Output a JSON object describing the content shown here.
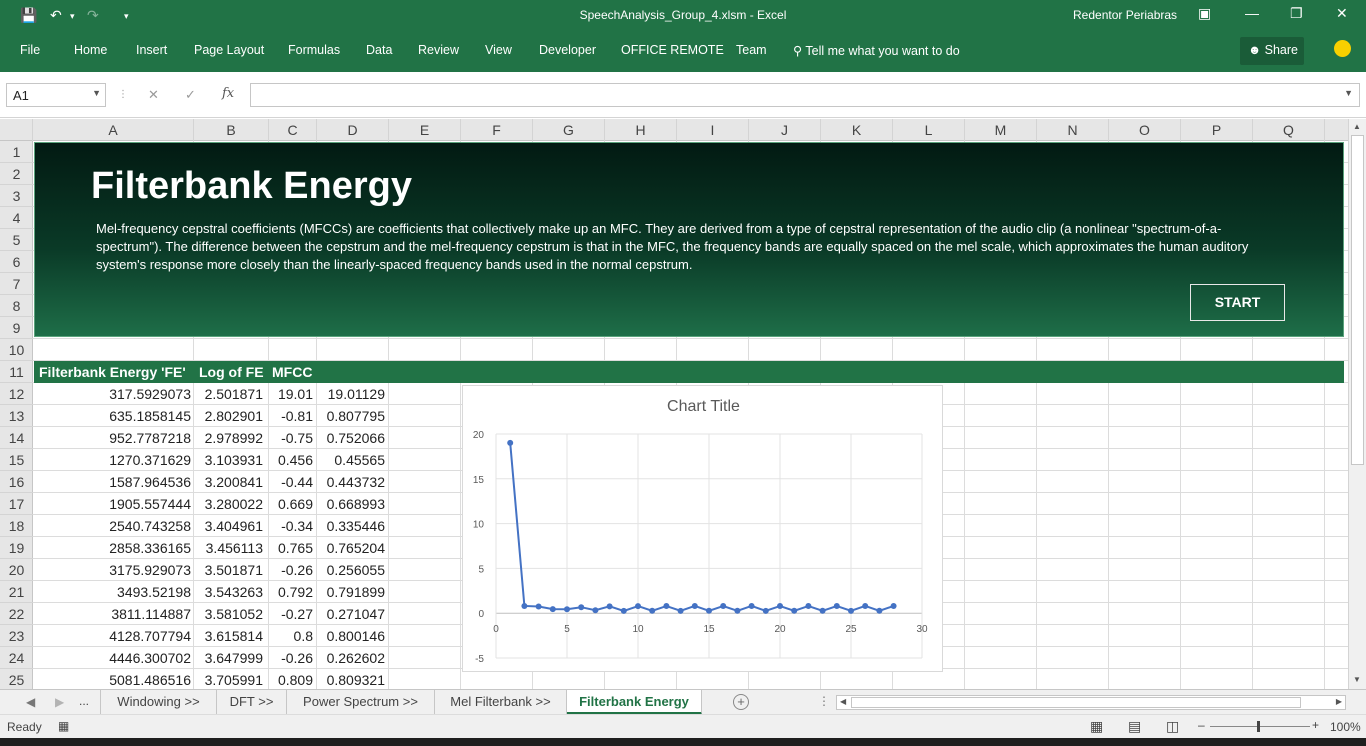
{
  "titlebar": {
    "file_title": "SpeechAnalysis_Group_4.xlsm",
    "app_name": "Excel",
    "separator": "-",
    "user": "Redentor Periabras"
  },
  "ribbon": {
    "tabs": [
      "File",
      "Home",
      "Insert",
      "Page Layout",
      "Formulas",
      "Data",
      "Review",
      "View",
      "Developer",
      "OFFICE REMOTE",
      "Team"
    ],
    "tell_me": "Tell me what you want to do",
    "share": "Share"
  },
  "formula_bar": {
    "name_box": "A1",
    "fx": "fx",
    "formula": ""
  },
  "columns": [
    "A",
    "B",
    "C",
    "D",
    "E",
    "F",
    "G",
    "H",
    "I",
    "J",
    "K",
    "L",
    "M",
    "N",
    "O",
    "P",
    "Q"
  ],
  "rows": [
    "1",
    "2",
    "3",
    "4",
    "5",
    "6",
    "7",
    "8",
    "9",
    "10",
    "11",
    "12",
    "13",
    "14",
    "15",
    "16",
    "17",
    "18",
    "19",
    "20",
    "21",
    "22",
    "23",
    "24",
    "25"
  ],
  "banner": {
    "title": "Filterbank Energy",
    "description": "Mel-frequency cepstral coefficients (MFCCs) are coefficients that collectively make up an MFC. They are derived from a type of cepstral representation of the audio clip (a nonlinear \"spectrum-of-a-spectrum\"). The difference between the cepstrum and the mel-frequency cepstrum is that in the MFC, the frequency bands are equally spaced on the mel scale, which approximates the human auditory system's response more closely than the linearly-spaced frequency bands used in the normal cepstrum.",
    "start_button": "START"
  },
  "table": {
    "headers": [
      "Filterbank Energy 'FE'",
      "Log of FE",
      "MFCC"
    ],
    "rows": [
      [
        "317.5929073",
        "2.501871",
        "19.01",
        "19.01129"
      ],
      [
        "635.1858145",
        "2.802901",
        "-0.81",
        "0.807795"
      ],
      [
        "952.7787218",
        "2.978992",
        "-0.75",
        "0.752066"
      ],
      [
        "1270.371629",
        "3.103931",
        "0.456",
        "0.45565"
      ],
      [
        "1587.964536",
        "3.200841",
        "-0.44",
        "0.443732"
      ],
      [
        "1905.557444",
        "3.280022",
        "0.669",
        "0.668993"
      ],
      [
        "2540.743258",
        "3.404961",
        "-0.34",
        "0.335446"
      ],
      [
        "2858.336165",
        "3.456113",
        "0.765",
        "0.765204"
      ],
      [
        "3175.929073",
        "3.501871",
        "-0.26",
        "0.256055"
      ],
      [
        "3493.52198",
        "3.543263",
        "0.792",
        "0.791899"
      ],
      [
        "3811.114887",
        "3.581052",
        "-0.27",
        "0.271047"
      ],
      [
        "4128.707794",
        "3.615814",
        "0.8",
        "0.800146"
      ],
      [
        "4446.300702",
        "3.647999",
        "-0.26",
        "0.262602"
      ],
      [
        "5081.486516",
        "3.705991",
        "0.809",
        "0.809321"
      ]
    ]
  },
  "chart_data": {
    "type": "line",
    "title": "Chart Title",
    "x": [
      1,
      2,
      3,
      4,
      5,
      6,
      7,
      8,
      9,
      10,
      11,
      12,
      13,
      14,
      15,
      16,
      17,
      18,
      19,
      20,
      21,
      22,
      23,
      24,
      25,
      26,
      27,
      28
    ],
    "series": [
      {
        "values": [
          19.01129,
          0.807795,
          0.752066,
          0.45565,
          0.443732,
          0.668993,
          0.335446,
          0.765204,
          0.256055,
          0.791899,
          0.271047,
          0.800146,
          0.262602,
          0.809321,
          0.27,
          0.8,
          0.27,
          0.81,
          0.26,
          0.8,
          0.27,
          0.8,
          0.27,
          0.8,
          0.26,
          0.81,
          0.27,
          0.8
        ]
      }
    ],
    "xlim": [
      0,
      30
    ],
    "ylim": [
      -5,
      20
    ],
    "xticks": [
      0,
      5,
      10,
      15,
      20,
      25,
      30
    ],
    "yticks": [
      -5,
      0,
      5,
      10,
      15,
      20
    ],
    "grid": true,
    "color": "#4472c4"
  },
  "sheet_tabs": {
    "ellipsis": "...",
    "tabs": [
      "Windowing >>",
      "DFT >>",
      "Power Spectrum >>",
      "Mel Filterbank >>",
      "Filterbank Energy"
    ],
    "active": "Filterbank Energy"
  },
  "status": {
    "ready": "Ready",
    "zoom": "100%"
  },
  "colors": {
    "excel_green": "#217346",
    "chart_line": "#4472c4"
  }
}
